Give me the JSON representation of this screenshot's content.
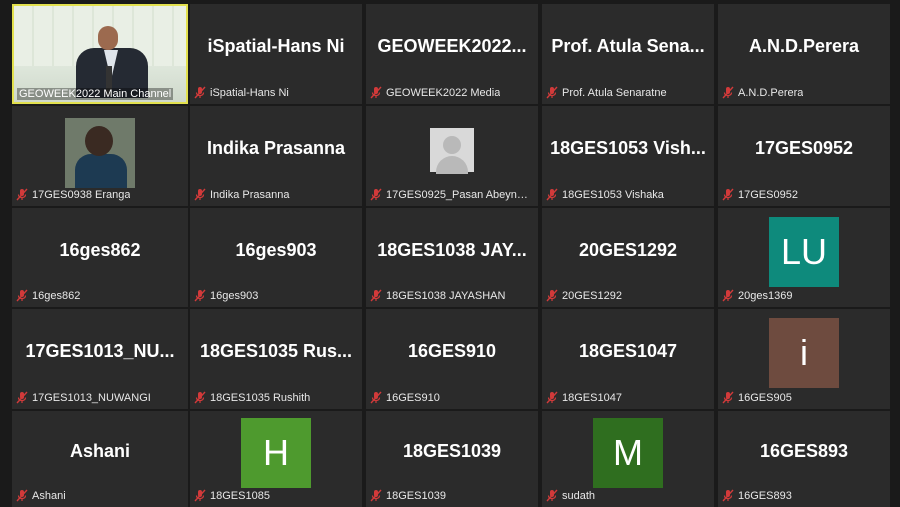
{
  "colors": {
    "tile_bg": "#2b2b2b",
    "active_border": "#e2e04e",
    "muted_mic": "#d23a3a"
  },
  "tiles": [
    {
      "label": "GEOWEEK2022 Main Channel",
      "type": "video",
      "active": true
    },
    {
      "name": "iSpatial-Hans Ni",
      "label": "iSpatial-Hans Ni",
      "type": "name"
    },
    {
      "name": "GEOWEEK2022...",
      "label": "GEOWEEK2022 Media",
      "type": "name"
    },
    {
      "name": "Prof. Atula Sena...",
      "label": "Prof. Atula Senaratne",
      "type": "name"
    },
    {
      "name": "A.N.D.Perera",
      "label": "A.N.D.Perera",
      "type": "name"
    },
    {
      "label": "17GES0938 Eranga",
      "type": "photo"
    },
    {
      "name": "Indika Prasanna",
      "label": "Indika Prasanna",
      "type": "name"
    },
    {
      "label": "17GES0925_Pasan Abeynaya...",
      "type": "gray-avatar"
    },
    {
      "name": "18GES1053  Vish...",
      "label": "18GES1053 Vishaka",
      "type": "name"
    },
    {
      "name": "17GES0952",
      "label": "17GES0952",
      "type": "name"
    },
    {
      "name": "16ges862",
      "label": "16ges862",
      "type": "name"
    },
    {
      "name": "16ges903",
      "label": "16ges903",
      "type": "name"
    },
    {
      "name": "18GES1038  JAY...",
      "label": "18GES1038 JAYASHAN",
      "type": "name"
    },
    {
      "name": "20GES1292",
      "label": "20GES1292",
      "type": "name"
    },
    {
      "initials": "LU",
      "label": "20ges1369",
      "type": "initials",
      "color": "#0e8a7c"
    },
    {
      "name": "17GES1013_NU...",
      "label": "17GES1013_NUWANGI",
      "type": "name"
    },
    {
      "name": "18GES1035  Rus...",
      "label": "18GES1035 Rushith",
      "type": "name"
    },
    {
      "name": "16GES910",
      "label": "16GES910",
      "type": "name"
    },
    {
      "name": "18GES1047",
      "label": "18GES1047",
      "type": "name"
    },
    {
      "initials": "i",
      "label": "16GES905",
      "type": "initials",
      "color": "#6e4b3f"
    },
    {
      "name": "Ashani",
      "label": "Ashani",
      "type": "name"
    },
    {
      "initials": "H",
      "label": "18GES1085",
      "type": "initials",
      "color": "#4e9a2e"
    },
    {
      "name": "18GES1039",
      "label": "18GES1039",
      "type": "name"
    },
    {
      "initials": "M",
      "label": "sudath",
      "type": "initials",
      "color": "#2f6e1f"
    },
    {
      "name": "16GES893",
      "label": "16GES893",
      "type": "name"
    }
  ]
}
